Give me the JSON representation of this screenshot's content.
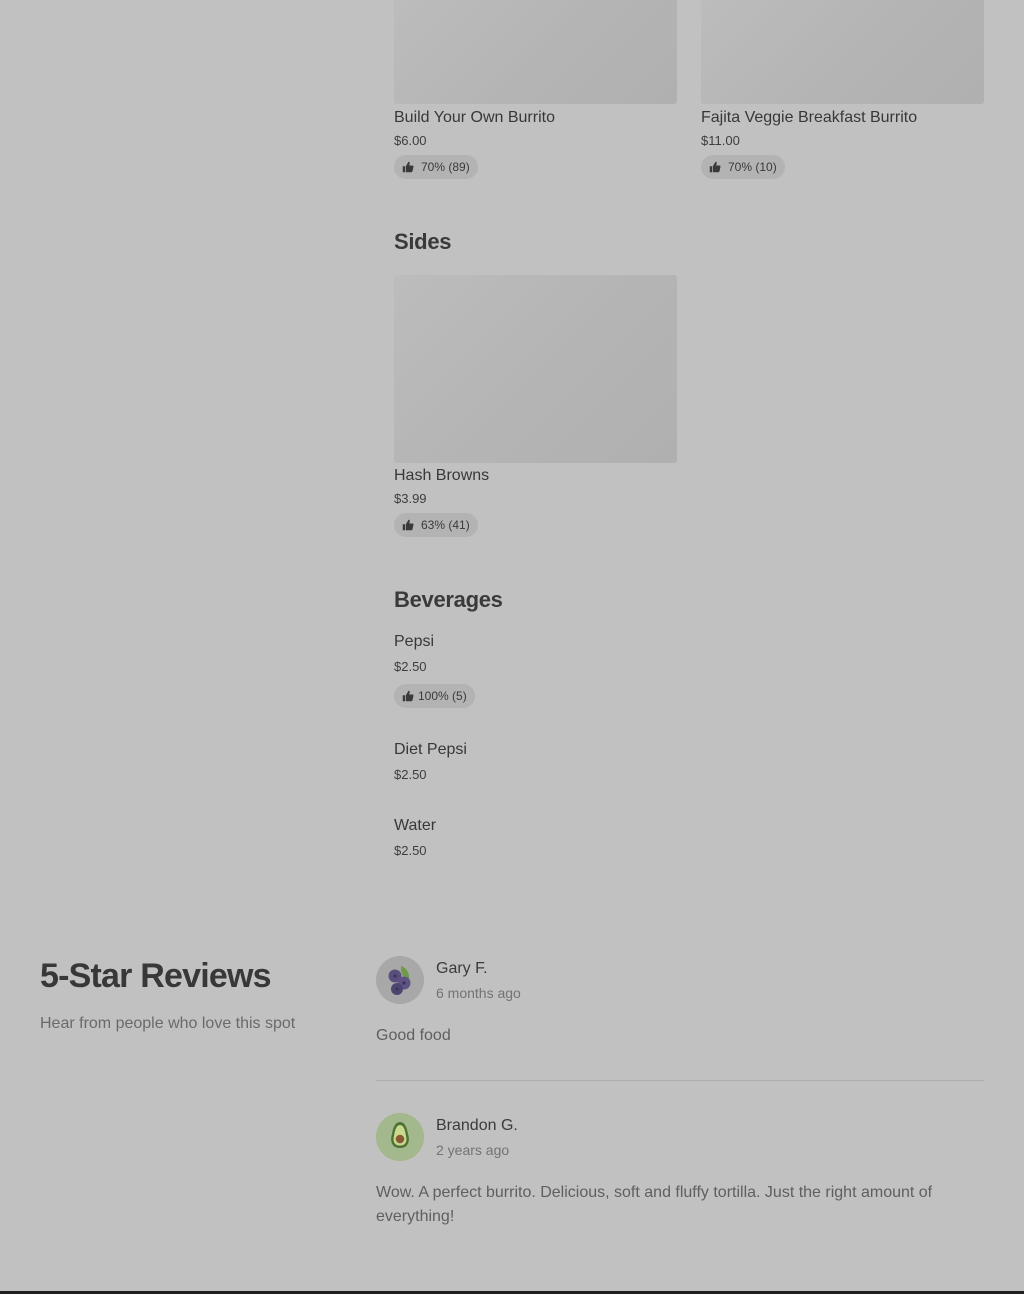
{
  "menu": {
    "breakfast_items": [
      {
        "name": "Build Your Own Burrito",
        "price": "$6.00",
        "rating": "70% (89)"
      },
      {
        "name": "Fajita Veggie Breakfast Burrito",
        "price": "$11.00",
        "rating": "70% (10)"
      }
    ],
    "sides": {
      "title": "Sides",
      "items": [
        {
          "name": "Hash Browns",
          "price": "$3.99",
          "rating": "63% (41)"
        }
      ]
    },
    "beverages": {
      "title": "Beverages",
      "items": [
        {
          "name": "Pepsi",
          "price": "$2.50",
          "rating": "100% (5)"
        },
        {
          "name": "Diet Pepsi",
          "price": "$2.50"
        },
        {
          "name": "Water",
          "price": "$2.50"
        }
      ]
    }
  },
  "reviews": {
    "title": "5-Star Reviews",
    "subtitle": "Hear from people who love this spot",
    "items": [
      {
        "name": "Gary F.",
        "time": "6 months ago",
        "text": "Good food",
        "avatar_icon": "blueberries-icon"
      },
      {
        "name": "Brandon G.",
        "time": "2 years ago",
        "text": "Wow. A perfect burrito. Delicious, soft and fluffy tortilla. Just the right amount of everything!",
        "avatar_icon": "avocado-icon"
      }
    ]
  },
  "icons": {
    "rating": "thumbs-up-icon"
  },
  "colors": {
    "page_background": "#c1c1c1",
    "rating_pill": "#b3b3b3",
    "text_primary": "#383838",
    "text_secondary": "#737373"
  }
}
